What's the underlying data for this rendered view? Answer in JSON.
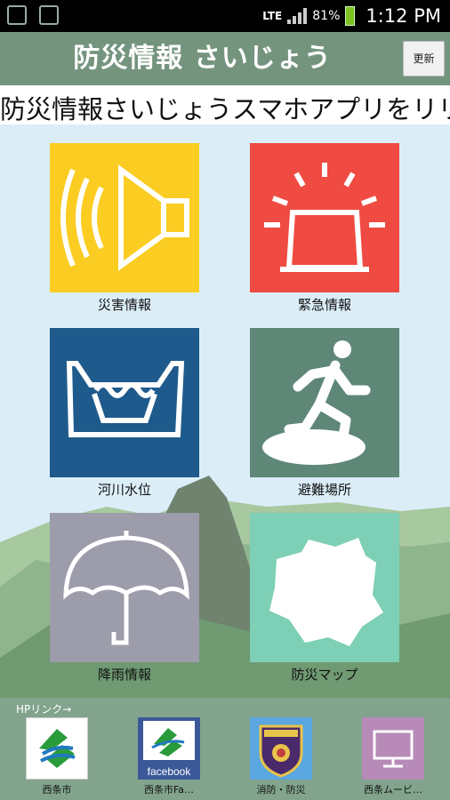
{
  "status_bar": {
    "network": "LTE",
    "battery": "81%",
    "time": "1:12 PM"
  },
  "header": {
    "title": "防災情報 さいじょう",
    "refresh_label": "更新"
  },
  "ticker": {
    "text": "防災情報さいじょうスマホアプリをリリー"
  },
  "menu": [
    {
      "label": "災害情報",
      "color": "#fbcc22",
      "icon": "speaker-icon"
    },
    {
      "label": "緊急情報",
      "color": "#ef4b42",
      "icon": "siren-icon"
    },
    {
      "label": "河川水位",
      "color": "#1f5a8c",
      "icon": "river-icon"
    },
    {
      "label": "避難場所",
      "color": "#5e8777",
      "icon": "evacuation-runner-icon"
    },
    {
      "label": "降雨情報",
      "color": "#9c9cab",
      "icon": "umbrella-icon"
    },
    {
      "label": "防災マップ",
      "color": "#7dcfb5",
      "icon": "map-icon"
    }
  ],
  "links": {
    "section_label": "HPリンク→",
    "items": [
      {
        "label": "西条市",
        "icon": "saijo-city-logo-icon"
      },
      {
        "label": "西条市Fa…",
        "icon": "facebook-logo-icon",
        "badge": "facebook"
      },
      {
        "label": "消防・防災",
        "icon": "fire-department-emblem-icon"
      },
      {
        "label": "西条ムービ…",
        "icon": "monitor-icon"
      }
    ]
  }
}
